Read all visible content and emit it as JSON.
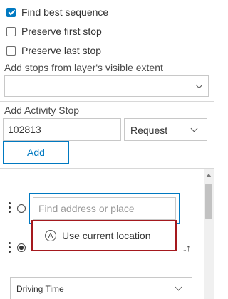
{
  "options": {
    "find_best_sequence": {
      "label": "Find best sequence",
      "checked": true
    },
    "preserve_first_stop": {
      "label": "Preserve first stop",
      "checked": false
    },
    "preserve_last_stop": {
      "label": "Preserve last stop",
      "checked": false
    }
  },
  "layer_stops": {
    "label": "Add stops from layer's visible extent",
    "selected": ""
  },
  "activity_stop": {
    "label": "Add Activity Stop",
    "id_value": "102813",
    "type_value": "Request",
    "add_label": "Add"
  },
  "stops": {
    "search_placeholder": "Find address or place",
    "suggestion_icon_letter": "A",
    "suggestion_label": "Use current location",
    "swap_glyph": "↓↑"
  },
  "travel_mode": {
    "selected": "Driving Time"
  },
  "colors": {
    "accent": "#0079c1",
    "highlight_border": "#a5191e"
  }
}
